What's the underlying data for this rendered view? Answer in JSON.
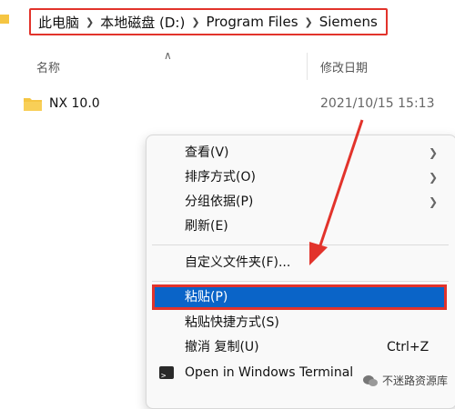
{
  "breadcrumb": {
    "items": [
      "此电脑",
      "本地磁盘 (D:)",
      "Program Files",
      "Siemens"
    ]
  },
  "columns": {
    "name": "名称",
    "date_modified": "修改日期"
  },
  "files": [
    {
      "name": "NX 10.0",
      "date": "2021/10/15 15:13"
    }
  ],
  "context_menu": {
    "view": "查看(V)",
    "sort": "排序方式(O)",
    "group": "分组依据(P)",
    "refresh": "刷新(E)",
    "customize": "自定义文件夹(F)...",
    "paste": "粘贴(P)",
    "paste_shortcut": "粘贴快捷方式(S)",
    "undo_copy": "撤消 复制(U)",
    "undo_shortcut": "Ctrl+Z",
    "open_terminal": "Open in Windows Terminal"
  },
  "watermark": "不迷路资源库",
  "colors": {
    "highlight": "#0a64c8",
    "annotation_red": "#e2332b",
    "folder": "#f5c542"
  }
}
